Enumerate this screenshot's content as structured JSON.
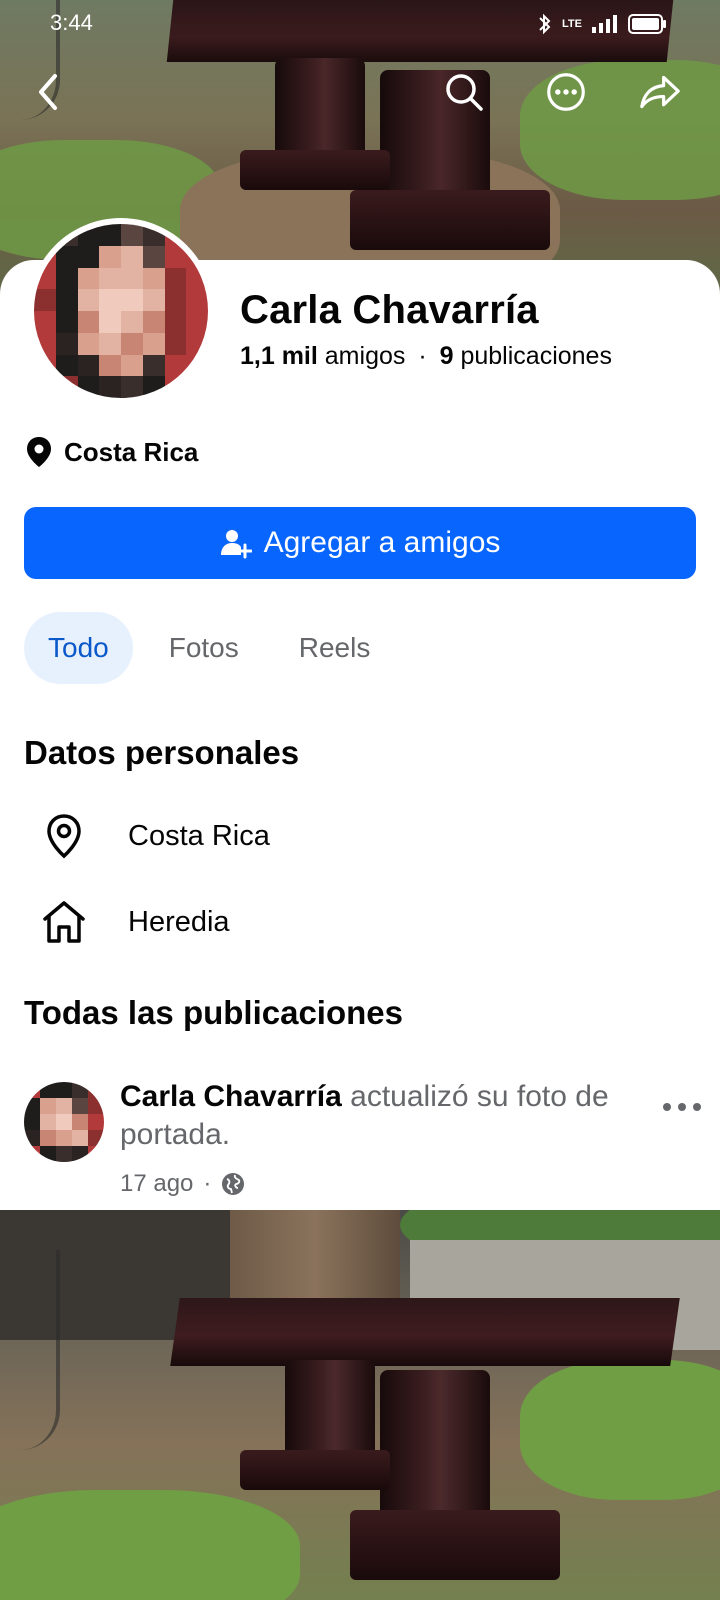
{
  "status_bar": {
    "time": "3:44",
    "network": "LTE"
  },
  "profile": {
    "name": "Carla Chavarría",
    "friends_count": "1,1 mil",
    "friends_label": "amigos",
    "separator": "·",
    "posts_count": "9",
    "posts_label": "publicaciones",
    "location": "Costa Rica"
  },
  "actions": {
    "add_friend_label": "Agregar a amigos"
  },
  "tabs": [
    {
      "label": "Todo",
      "active": true
    },
    {
      "label": "Fotos",
      "active": false
    },
    {
      "label": "Reels",
      "active": false
    }
  ],
  "personal": {
    "title": "Datos personales",
    "items": [
      {
        "icon": "location-pin-icon",
        "text": "Costa Rica"
      },
      {
        "icon": "home-icon",
        "text": "Heredia"
      }
    ]
  },
  "posts": {
    "title": "Todas las publicaciones",
    "items": [
      {
        "author": "Carla Chavarría",
        "action": "actualizó su foto de portada.",
        "time": "17 ago",
        "separator": "·",
        "audience_icon": "globe-icon"
      }
    ]
  },
  "colors": {
    "primary": "#0866ff",
    "tab_active_bg": "#e7f0fd",
    "tab_active_text": "#0a58ca",
    "secondary_text": "#65676b"
  }
}
